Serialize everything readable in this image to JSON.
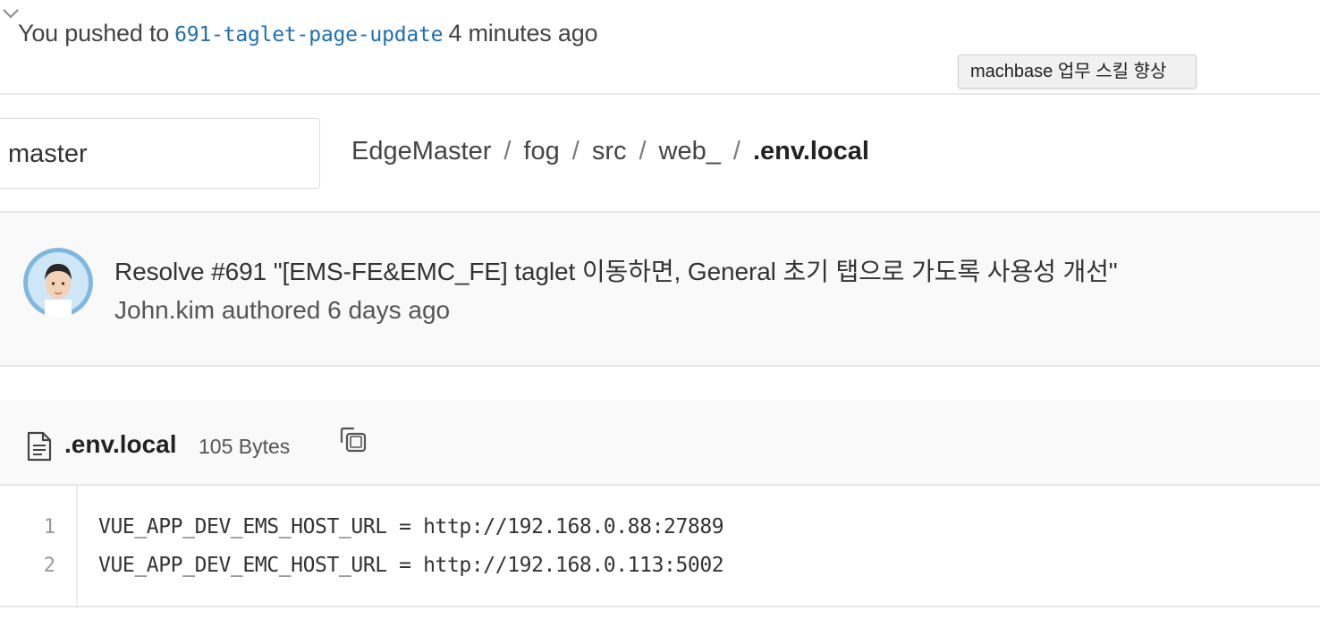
{
  "push_banner": {
    "prefix": "You pushed to",
    "branch": "691-taglet-page-update",
    "suffix": "4 minutes ago"
  },
  "tooltip": {
    "text": "machbase 업무 스킬 향상"
  },
  "branch_selector": {
    "value": "master"
  },
  "breadcrumb": {
    "items": [
      "EdgeMaster",
      "fog",
      "src",
      "web_"
    ],
    "current": ".env.local",
    "separator": "/"
  },
  "commit": {
    "title": "Resolve #691 \"[EMS-FE&EMC_FE] taglet 이동하면, General 초기 탭으로 가도록 사용성 개선\"",
    "author_line": "John.kim authored 6 days ago"
  },
  "file": {
    "name": ".env.local",
    "size": "105 Bytes",
    "lines": [
      {
        "no": "1",
        "code": "VUE_APP_DEV_EMS_HOST_URL = http://192.168.0.88:27889"
      },
      {
        "no": "2",
        "code": "VUE_APP_DEV_EMC_HOST_URL = http://192.168.0.113:5002"
      }
    ]
  },
  "icons": {
    "chevron": "chevron-down-icon",
    "file": "file-text-icon",
    "copy": "copy-icon"
  },
  "colors": {
    "branch_link": "#1f6fb2",
    "panel_bg": "#f9f9f9"
  }
}
